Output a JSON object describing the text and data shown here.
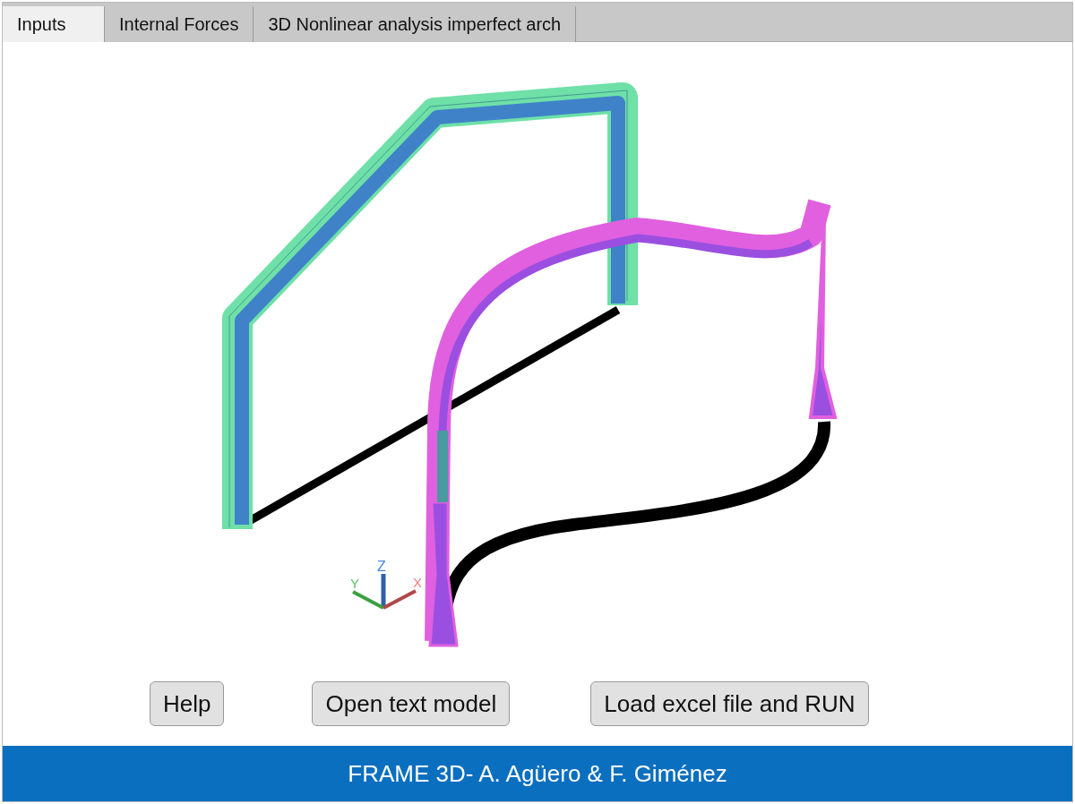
{
  "tabs": [
    {
      "label": "Inputs",
      "selected": true
    },
    {
      "label": "Internal Forces",
      "selected": false
    },
    {
      "label": "3D Nonlinear analysis imperfect arch",
      "selected": false
    }
  ],
  "axes": {
    "x": "X",
    "y": "Y",
    "z": "Z"
  },
  "buttons": [
    "Help",
    "Open text model",
    "Load excel file and RUN"
  ],
  "footer": "FRAME 3D- A. Agüero & F. Giménez"
}
